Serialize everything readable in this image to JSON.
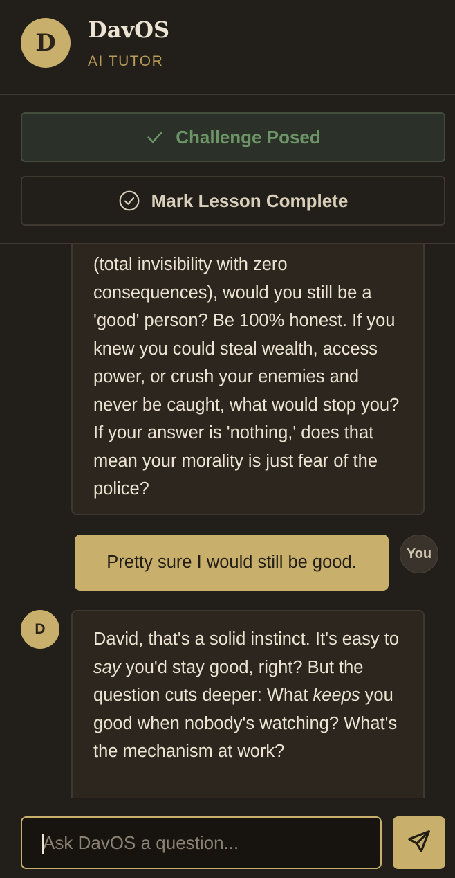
{
  "header": {
    "avatar_initial": "D",
    "title": "DavOS",
    "subtitle": "AI TUTOR"
  },
  "actions": {
    "challenge_label": "Challenge Posed",
    "complete_label": "Mark Lesson Complete"
  },
  "chat": {
    "messages": [
      {
        "role": "ai",
        "text": "(total invisibility with zero consequences), would you still be a 'good' person? Be 100% honest. If you knew you could steal wealth, access power, or crush your enemies and never be caught, what would stop you? If your answer is 'nothing,' does that mean your morality is just fear of the police?"
      },
      {
        "role": "user",
        "avatar_label": "You",
        "text": "Pretty sure I would still be good."
      },
      {
        "role": "ai",
        "avatar_initial": "D",
        "part1": "David, that's a solid instinct. It's easy to ",
        "em1": "say",
        "part2": " you'd stay good, right? But the question cuts deeper: What ",
        "em2": "keeps",
        "part3": " you good when nobody's watching? What's the mechanism at work?"
      }
    ]
  },
  "input": {
    "placeholder": "Ask DavOS a question..."
  },
  "colors": {
    "background": "#221f1a",
    "accent_gold": "#c8b06c",
    "success_green": "#6c9466",
    "bubble_bg": "#2c261e"
  },
  "icons": {
    "challenge": "check-icon",
    "complete": "check-circle-icon",
    "send": "send-icon"
  }
}
